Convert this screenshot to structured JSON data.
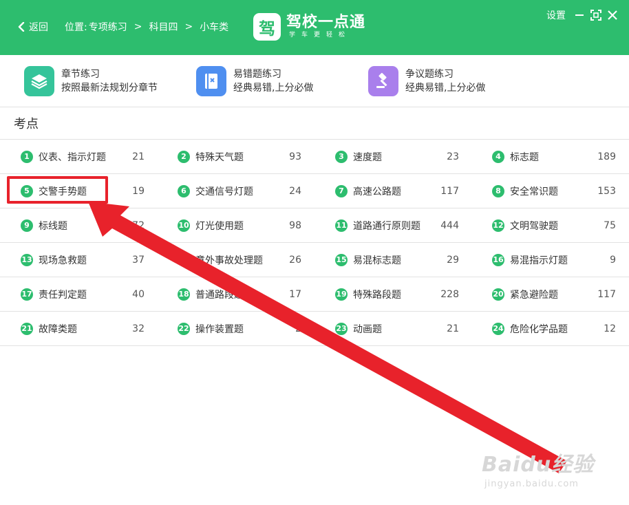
{
  "header": {
    "back_label": "返回",
    "location_label": "位置:",
    "crumbs": [
      "专项练习",
      "科目四",
      "小车类"
    ],
    "crumb_separator": ">",
    "logo_mark": "驾",
    "logo_name": "驾校一点通",
    "logo_slogan": "学车更轻松",
    "settings_label": "设置"
  },
  "modes": [
    {
      "title": "章节练习",
      "subtitle": "按照最新法规划分章节",
      "icon": "layers-icon",
      "color": "#35c49a"
    },
    {
      "title": "易错题练习",
      "subtitle": "经典易错,上分必做",
      "icon": "notebook-icon",
      "color": "#4f8ff0"
    },
    {
      "title": "争议题练习",
      "subtitle": "经典易错,上分必做",
      "icon": "gavel-icon",
      "color": "#a97fec"
    }
  ],
  "section_title": "考点",
  "topics": [
    {
      "num": "1",
      "label": "仪表、指示灯题",
      "count": "21"
    },
    {
      "num": "2",
      "label": "特殊天气题",
      "count": "93"
    },
    {
      "num": "3",
      "label": "速度题",
      "count": "23"
    },
    {
      "num": "4",
      "label": "标志题",
      "count": "189"
    },
    {
      "num": "5",
      "label": "交警手势题",
      "count": "19"
    },
    {
      "num": "6",
      "label": "交通信号灯题",
      "count": "24"
    },
    {
      "num": "7",
      "label": "高速公路题",
      "count": "117"
    },
    {
      "num": "8",
      "label": "安全常识题",
      "count": "153"
    },
    {
      "num": "9",
      "label": "标线题",
      "count": "72"
    },
    {
      "num": "10",
      "label": "灯光使用题",
      "count": "98"
    },
    {
      "num": "11",
      "label": "道路通行原则题",
      "count": "444"
    },
    {
      "num": "12",
      "label": "文明驾驶题",
      "count": "75"
    },
    {
      "num": "13",
      "label": "现场急救题",
      "count": "37"
    },
    {
      "num": "14",
      "label": "意外事故处理题",
      "count": "26"
    },
    {
      "num": "15",
      "label": "易混标志题",
      "count": "29"
    },
    {
      "num": "16",
      "label": "易混指示灯题",
      "count": "9"
    },
    {
      "num": "17",
      "label": "责任判定题",
      "count": "40"
    },
    {
      "num": "18",
      "label": "普通路段题",
      "count": "17"
    },
    {
      "num": "19",
      "label": "特殊路段题",
      "count": "228"
    },
    {
      "num": "20",
      "label": "紧急避险题",
      "count": "117"
    },
    {
      "num": "21",
      "label": "故障类题",
      "count": "32"
    },
    {
      "num": "22",
      "label": "操作装置题",
      "count": "2"
    },
    {
      "num": "23",
      "label": "动画题",
      "count": "21"
    },
    {
      "num": "24",
      "label": "危险化学品题",
      "count": "12"
    }
  ],
  "highlighted_topic": "5",
  "colors": {
    "brand": "#2dbd6e",
    "annotation": "#e8222b",
    "text": "#333333",
    "border": "#e2e2e2"
  },
  "watermark": {
    "main": "Baidu经验",
    "sub": "jingyan.baidu.com"
  }
}
